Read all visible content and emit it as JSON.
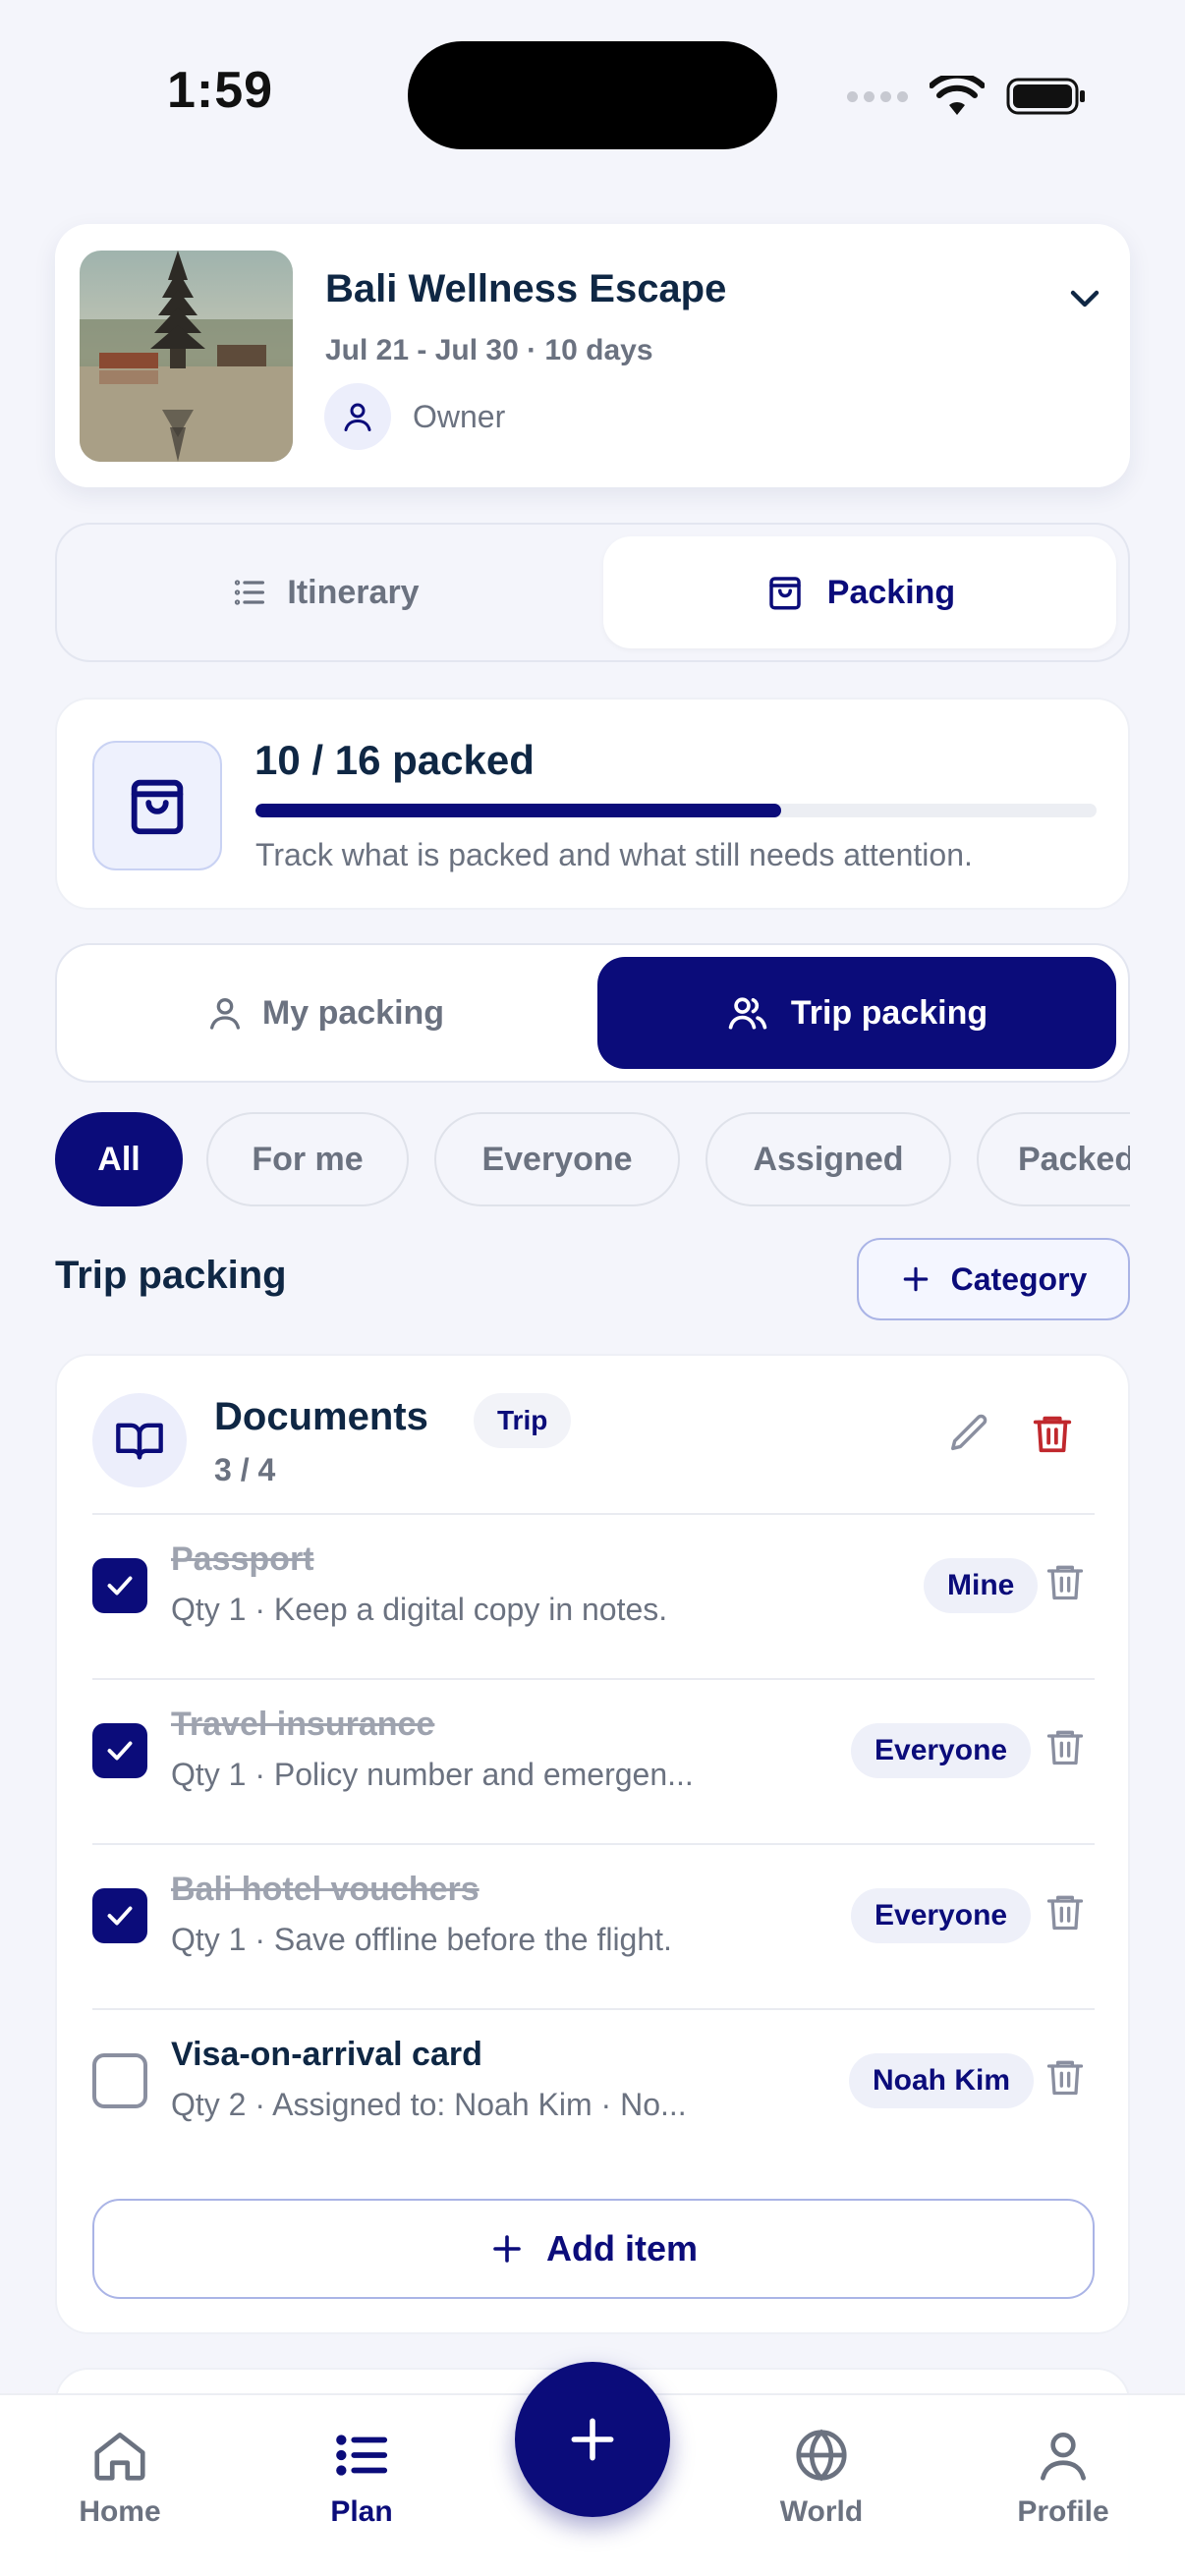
{
  "status_bar": {
    "time": "1:59"
  },
  "trip": {
    "title": "Bali Wellness Escape",
    "dates": "Jul 21 - Jul 30 · 10 days",
    "role": "Owner"
  },
  "view_tabs": [
    {
      "label": "Itinerary",
      "icon": "list-icon",
      "active": false
    },
    {
      "label": "Packing",
      "icon": "bag-icon",
      "active": true
    }
  ],
  "progress": {
    "title": "10 / 16 packed",
    "packed": 10,
    "total": 16,
    "subtitle": "Track what is packed and what still needs attention."
  },
  "scope_tabs": [
    {
      "label": "My packing",
      "icon": "user-icon",
      "active": false
    },
    {
      "label": "Trip packing",
      "icon": "users-icon",
      "active": true
    }
  ],
  "filters": [
    "All",
    "For me",
    "Everyone",
    "Assigned",
    "Packed"
  ],
  "active_filter": "All",
  "section": {
    "title": "Trip packing",
    "add_category_label": "Category"
  },
  "category": {
    "name": "Documents",
    "tag": "Trip",
    "count": "3 / 4",
    "items": [
      {
        "name": "Passport",
        "sub": "Qty 1 · Keep a digital copy in notes.",
        "badge": "Mine",
        "checked": true
      },
      {
        "name": "Travel insurance",
        "sub": "Qty 1 · Policy number and emergen...",
        "badge": "Everyone",
        "checked": true
      },
      {
        "name": "Bali hotel vouchers",
        "sub": "Qty 1 · Save offline before the flight.",
        "badge": "Everyone",
        "checked": true
      },
      {
        "name": "Visa-on-arrival card",
        "sub": "Qty 2 · Assigned to: Noah Kim · No...",
        "badge": "Noah Kim",
        "checked": false
      }
    ],
    "add_item_label": "Add item"
  },
  "bottom_nav": [
    {
      "label": "Home",
      "icon": "home-icon",
      "active": false
    },
    {
      "label": "Plan",
      "icon": "plan-list-icon",
      "active": true
    },
    {
      "label": "World",
      "icon": "globe-icon",
      "active": false
    },
    {
      "label": "Profile",
      "icon": "profile-icon",
      "active": false
    }
  ],
  "colors": {
    "accent": "#0b0c7a",
    "danger": "#c0282d",
    "muted": "#6b7280"
  }
}
